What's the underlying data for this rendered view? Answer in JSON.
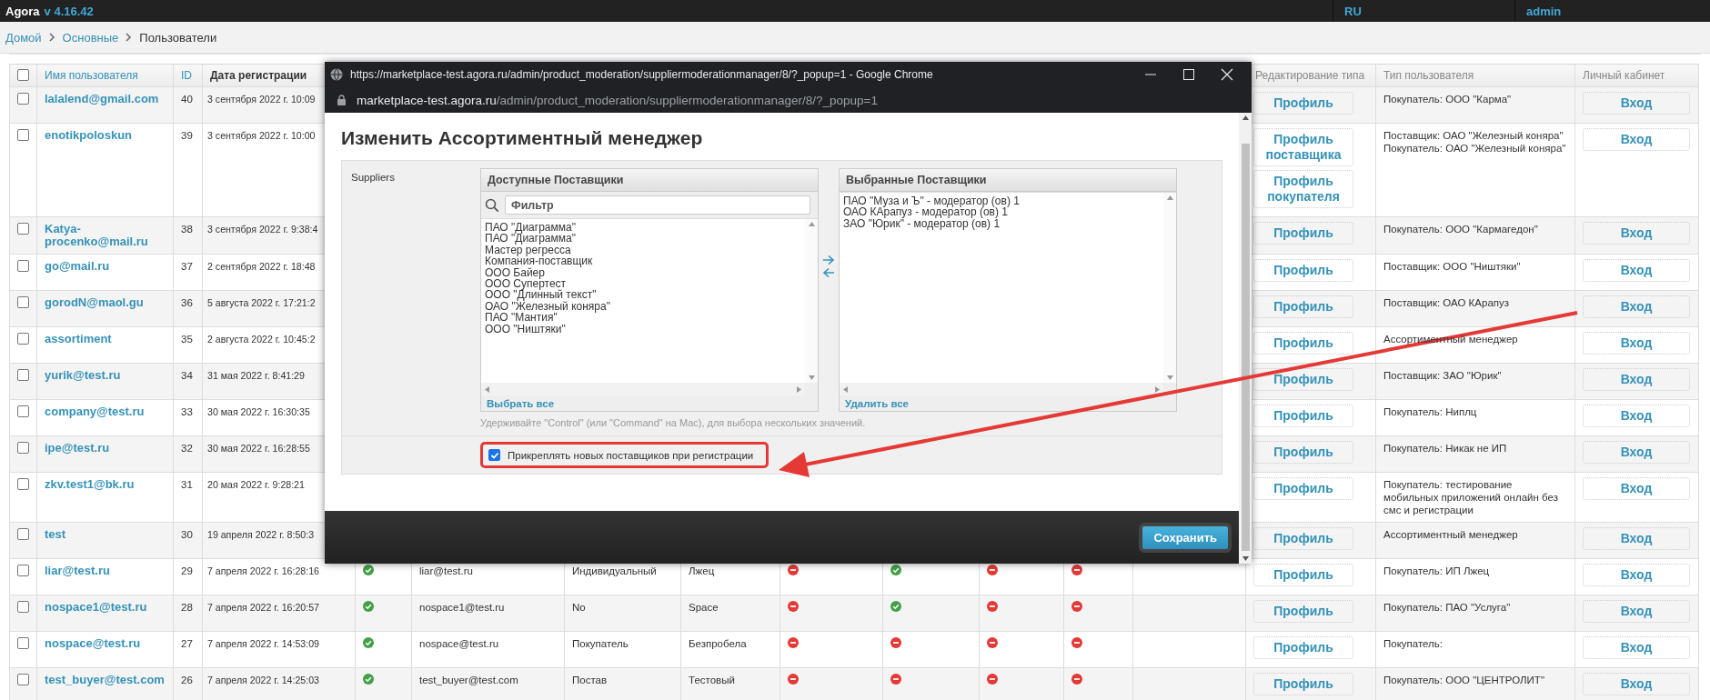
{
  "topbar": {
    "brand": "Agora",
    "version": "v 4.16.42",
    "language": "RU",
    "user": "admin"
  },
  "breadcrumbs": [
    {
      "label": "Домой",
      "link": true
    },
    {
      "label": "Основные",
      "link": true
    },
    {
      "label": "Пользователи",
      "link": false
    }
  ],
  "header": {
    "select_all_checked": false,
    "username": "Имя пользователя",
    "id": "ID",
    "date": "Дата регистрации",
    "edit_type": "Редактирование типа",
    "user_type": "Тип пользователя",
    "cabinet": "Личный кабинет"
  },
  "rows": [
    {
      "checked": false,
      "username": "lalalend@gmail.com",
      "id": "40",
      "date": "3 сентября 2022 г. 10:09",
      "profiles": [
        "Профиль"
      ],
      "user_type": [
        "Покупатель: ООО \"Карма\""
      ],
      "login": "Вход"
    },
    {
      "checked": false,
      "username": "enotikpoloskun",
      "id": "39",
      "date": "3 сентября 2022 г. 10:00",
      "profiles": [
        "Профиль поставщика",
        "Профиль покупателя"
      ],
      "user_type": [
        "Поставщик: ОАО \"Железный коняра\"",
        "Покупатель: ОАО \"Железный коняра\""
      ],
      "login": "Вход"
    },
    {
      "checked": false,
      "username": "Katya-procenko@mail.ru",
      "id": "38",
      "date": "3 сентября 2022 г. 9:38:4",
      "profiles": [
        "Профиль"
      ],
      "user_type": [
        "Покупатель: ООО \"Кармагедон\""
      ],
      "login": "Вход"
    },
    {
      "checked": false,
      "username": "go@mail.ru",
      "id": "37",
      "date": "2 сентября 2022 г. 18:48",
      "profiles": [
        "Профиль"
      ],
      "user_type": [
        "Поставщик: ООО \"Ништяки\""
      ],
      "login": "Вход"
    },
    {
      "checked": false,
      "username": "gorodN@maol.gu",
      "id": "36",
      "date": "5 августа 2022 г. 17:21:2",
      "profiles": [
        "Профиль"
      ],
      "user_type": [
        "Поставщик: ОАО КАрапуз"
      ],
      "login": "Вход"
    },
    {
      "checked": false,
      "username": "assortiment",
      "id": "35",
      "date": "2 августа 2022 г. 10:45:2",
      "profiles": [
        "Профиль"
      ],
      "user_type": [
        "Ассортиментный менеджер"
      ],
      "login": "Вход"
    },
    {
      "checked": false,
      "username": "yurik@test.ru",
      "id": "34",
      "date": "31 мая 2022 г. 8:41:29",
      "profiles": [
        "Профиль"
      ],
      "user_type": [
        "Поставщик: ЗАО \"Юрик\""
      ],
      "login": "Вход"
    },
    {
      "checked": false,
      "username": "company@test.ru",
      "id": "33",
      "date": "30 мая 2022 г. 16:30:35",
      "profiles": [
        "Профиль"
      ],
      "user_type": [
        "Покупатель: Ниплц"
      ],
      "login": "Вход"
    },
    {
      "checked": false,
      "username": "ipe@test.ru",
      "id": "32",
      "date": "30 мая 2022 г. 16:28:55",
      "profiles": [
        "Профиль"
      ],
      "user_type": [
        "Покупатель: Никак не ИП"
      ],
      "login": "Вход"
    },
    {
      "checked": false,
      "username": "zkv.test1@bk.ru",
      "id": "31",
      "date": "20 мая 2022 г. 9:28:21",
      "profiles": [
        "Профиль"
      ],
      "user_type": [
        "Покупатель: тестирование мобильных приложений онлайн без смс и регистрации"
      ],
      "login": "Вход"
    },
    {
      "checked": false,
      "username": "test",
      "id": "30",
      "date": "19 апреля 2022 г. 8:50:3",
      "profiles": [
        "Профиль"
      ],
      "user_type": [
        "Ассортиментный менеджер"
      ],
      "login": "Вход"
    },
    {
      "checked": false,
      "username": "liar@test.ru",
      "id": "29",
      "date": "7 апреля 2022 г. 16:28:16",
      "active": true,
      "email": "liar@test.ru",
      "type": "Индивидуальный",
      "name": "Лжец",
      "flags": [
        false,
        true,
        false,
        false
      ],
      "profiles": [
        "Профиль"
      ],
      "user_type": [
        "Покупатель: ИП Лжец"
      ],
      "login": "Вход"
    },
    {
      "checked": false,
      "username": "nospace1@test.ru",
      "id": "28",
      "date": "7 апреля 2022 г. 16:20:57",
      "active": true,
      "email": "nospace1@test.ru",
      "type": "No",
      "name": "Space",
      "flags": [
        false,
        true,
        false,
        false
      ],
      "profiles": [
        "Профиль"
      ],
      "user_type": [
        "Покупатель: ПАО \"Услуга\""
      ],
      "login": "Вход"
    },
    {
      "checked": false,
      "username": "nospace@test.ru",
      "id": "27",
      "date": "7 апреля 2022 г. 14:53:09",
      "active": true,
      "email": "nospace@test.ru",
      "type": "Покупатель",
      "name": "Безпробела",
      "flags": [
        false,
        false,
        false,
        false
      ],
      "profiles": [
        "Профиль"
      ],
      "user_type": [
        "Покупатель:"
      ],
      "login": "Вход"
    },
    {
      "checked": false,
      "username": "test_buyer@test.com",
      "id": "26",
      "date": "7 апреля 2022 г. 14:25:03",
      "active": true,
      "email": "test_buyer@test.com",
      "type": "Постав",
      "name": "Тестовый",
      "flags": [
        false,
        false,
        false,
        false
      ],
      "profiles": [
        "Профиль"
      ],
      "user_type": [
        "Покупатель: ООО \"ЦЕНТРОЛИТ\""
      ],
      "login": "Вход"
    }
  ],
  "popup": {
    "title": "https://marketplace-test.agora.ru/admin/product_moderation/suppliermoderationmanager/8/?_popup=1 - Google Chrome",
    "address_host": "marketplace-test.agora.ru",
    "address_path": "/admin/product_moderation/suppliermoderationmanager/8/?_popup=1",
    "heading": "Изменить Ассортиментный менеджер",
    "field_label": "Suppliers",
    "available": {
      "title": "Доступные Поставщики",
      "filter_placeholder": "Фильтр",
      "action": "Выбрать все",
      "items": [
        "ПАО \"Диаграмма\"",
        "ПАО \"Диаграмма\"",
        "Мастер регресса",
        "Компания-поставщик",
        "ООО Байер",
        "ООО Супертест",
        "ООО \"Длинный текст\"",
        "ОАО \"Железный коняра\"",
        "ПАО \"Мантия\"",
        "ООО \"Ништяки\""
      ]
    },
    "chosen": {
      "title": "Выбранные Поставщики",
      "action": "Удалить все",
      "items": [
        "ПАО \"Муза и Ъ\" - модератор (ов) 1",
        "ОАО КАрапуз - модератор (ов) 1",
        "ЗАО \"Юрик\" - модератор (ов) 1"
      ]
    },
    "help": "Удерживайте \"Control\" (или \"Command\" на Mac), для выбора нескольких значений.",
    "attach": {
      "label": "Прикреплять новых поставщиков при регистрации",
      "checked": true
    },
    "save": "Сохранить"
  }
}
